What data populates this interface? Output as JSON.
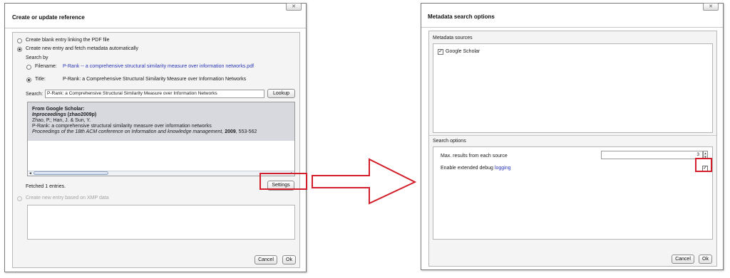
{
  "left_dialog": {
    "title": "Create or update reference",
    "close_label": "✕",
    "option_blank": "Create blank entry linking the PDF file",
    "option_fetch": "Create new entry and fetch metadata automatically",
    "search_by": "Search by",
    "filename_label": "Filename:",
    "filename_value": "P-Rank -- a comprehensive structural similarity measure over information networks.pdf",
    "title_label": "Title:",
    "title_value": "P-Rank: a Comprehensive Structural Similarity Measure over Information Networks",
    "search_label": "Search:",
    "search_value": "P-Rank: a Comprehensive Structural Similarity Measure over Information Networks",
    "lookup_button": "Lookup",
    "result": {
      "source": "From Google Scholar:",
      "entry_type": "Inproceedings",
      "key": "(zhao2009p)",
      "authors": "Zhao, P.; Han, J. & Sun, Y.",
      "title": "P-Rank: a comprehensive structural similarity measure over information networks",
      "venue": "Proceedings of the 18th ACM conference on Information and knowledge management,",
      "year": "2009",
      "pages": ", 553-562"
    },
    "status": "Fetched 1 entries.",
    "settings_button": "Settings",
    "option_xmp": "Create new entry based on XMP data",
    "cancel_button": "Cancel",
    "ok_button": "Ok"
  },
  "right_dialog": {
    "title": "Metadata search options",
    "close_label": "✕",
    "sources_heading": "Metadata sources",
    "source_google": "Google Scholar",
    "search_options_heading": "Search options",
    "max_results_label": "Max. results from each source",
    "max_results_value": "3",
    "debug_label_prefix": "Enable extended debug ",
    "debug_label_link": "logging",
    "cancel_button": "Cancel",
    "ok_button": "Ok"
  },
  "colors": {
    "highlight": "#d21f2b",
    "link": "#2a36b5",
    "result_background": "#d7d9df"
  }
}
